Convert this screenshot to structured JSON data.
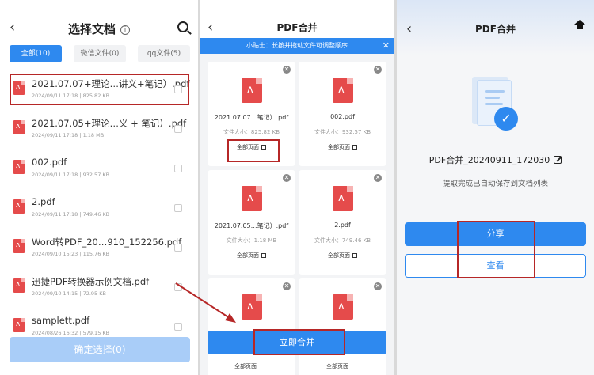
{
  "colors": {
    "accent": "#2e89ef",
    "highlight": "#b62727",
    "pdf": "#e54b4b"
  },
  "panel1": {
    "title": "选择文档",
    "filters": [
      "全部(10)",
      "微信文件(0)",
      "qq文件(5)"
    ],
    "files": [
      {
        "name": "2021.07.07+理论…讲义+笔记）.pdf",
        "meta": "2024/09/11 17:18  |   825.82 KB"
      },
      {
        "name": "2021.07.05+理论…义 + 笔记）.pdf",
        "meta": "2024/09/11 17:18  |   1.18 MB"
      },
      {
        "name": "002.pdf",
        "meta": "2024/09/11 17:18  |   932.57 KB"
      },
      {
        "name": "2.pdf",
        "meta": "2024/09/11 17:18  |   749.46 KB"
      },
      {
        "name": "Word转PDF_20…910_152256.pdf",
        "meta": "2024/09/10 15:23  |   115.76 KB"
      },
      {
        "name": "迅捷PDF转换器示例文档.pdf",
        "meta": "2024/09/10 14:15  |   72.95 KB"
      },
      {
        "name": "samplett.pdf",
        "meta": "2024/08/26 16:32  |   579.15 KB"
      }
    ],
    "confirm_label": "确定选择(0)"
  },
  "panel2": {
    "title": "PDF合并",
    "tip": "小贴士：长按并拖动文件可调整顺序",
    "close": "✕",
    "cards": [
      {
        "name": "2021.07.07…笔记）.pdf",
        "size": "文件大小：825.82 KB",
        "pages": "全部页面"
      },
      {
        "name": "002.pdf",
        "size": "文件大小：932.57 KB",
        "pages": "全部页面"
      },
      {
        "name": "2021.07.05…笔记）.pdf",
        "size": "文件大小：1.18 MB",
        "pages": "全部页面"
      },
      {
        "name": "2.pdf",
        "size": "文件大小：749.46 KB",
        "pages": "全部页面"
      },
      {
        "name": "",
        "size": "",
        "pages": ""
      },
      {
        "name": "",
        "size": "",
        "pages": ""
      }
    ],
    "merge_label": "立即合并",
    "bottom_pages_left": "全部页面",
    "bottom_pages_right": "全部页面"
  },
  "panel3": {
    "title": "PDF合并",
    "result_name": "PDF合并_20240911_172030",
    "result_sub": "提取完成已自动保存到文档列表",
    "share_label": "分享",
    "view_label": "查看"
  },
  "icons": [
    "back-icon",
    "info-icon",
    "search-icon",
    "pdf-file-icon",
    "checkbox-icon",
    "close-icon",
    "edit-icon",
    "home-icon",
    "check-circle-icon"
  ]
}
